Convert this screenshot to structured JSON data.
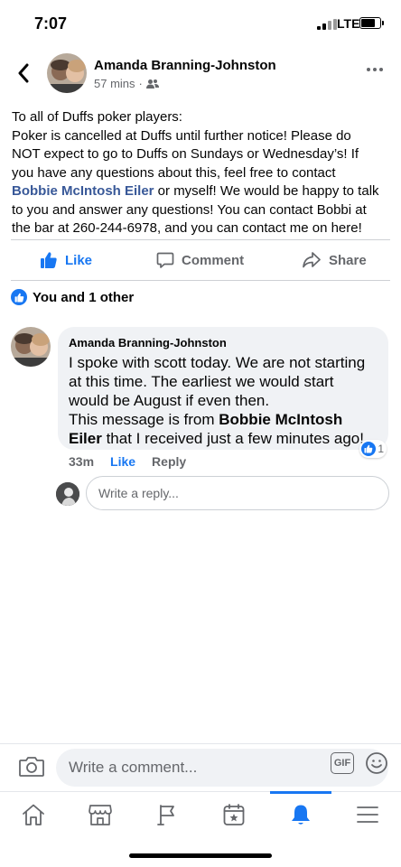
{
  "status_bar": {
    "time": "7:07",
    "network": "LTE"
  },
  "post": {
    "author": "Amanda Branning-Johnston",
    "time": "57 mins",
    "separator": "·",
    "body_lines": [
      "To all of Duffs poker players:",
      "Poker is cancelled at Duffs until further notice! Please do",
      "NOT expect to go to Duffs on Sundays or Wednesday’s! If",
      "you have any questions about this, feel free to contact"
    ],
    "mention": "Bobbie McIntosh Eiler",
    "body_after_mention": " or myself! We would be happy to talk",
    "body_lines_tail": [
      "to you and answer any questions! You can contact Bobbi at",
      "the bar at 260-244-6978, and you can contact me on here!"
    ]
  },
  "actions": {
    "like": "Like",
    "comment": "Comment",
    "share": "Share"
  },
  "reactions_summary": "You and 1 other",
  "comment": {
    "author": "Amanda Branning-Johnston",
    "line1": "I spoke with scott today. We are not starting",
    "line2": "at this time. The earliest we would start",
    "line3": "would be August if even then.",
    "line4_prefix": "This message is from ",
    "line4_bold": "Bobbie McIntosh",
    "line5_bold": "Eiler",
    "line5_suffix": " that I received just a few minutes ago!",
    "time": "33m",
    "like": "Like",
    "reply": "Reply",
    "reaction_count": "1"
  },
  "reply_input": {
    "placeholder": "Write a reply..."
  },
  "composer": {
    "placeholder": "Write a comment...",
    "gif_label": "GIF"
  },
  "colors": {
    "accent": "#1877f2",
    "secondary_text": "#65676b",
    "bubble": "#f0f2f5",
    "mention": "#385898"
  },
  "tabs": [
    {
      "icon": "home-icon"
    },
    {
      "icon": "marketplace-icon"
    },
    {
      "icon": "pages-flag-icon"
    },
    {
      "icon": "events-calendar-icon"
    },
    {
      "icon": "notifications-bell-icon",
      "active": true
    },
    {
      "icon": "menu-icon"
    }
  ]
}
